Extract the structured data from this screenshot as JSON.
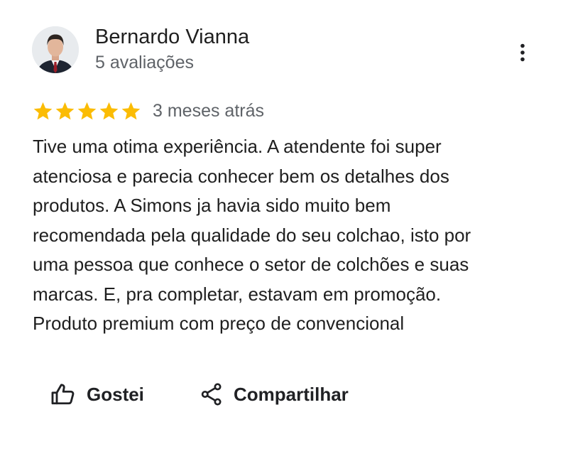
{
  "review": {
    "author": {
      "name": "Bernardo Vianna",
      "reviews_count": "5 avaliações",
      "avatar_icon": "profile-photo-man-in-suit"
    },
    "rating": {
      "stars": 5,
      "max_stars": 5,
      "star_color": "#fbbc04"
    },
    "date": "3 meses atrás",
    "text_lines": [
      "Tive uma otima experiência. A atendente foi super",
      "atenciosa e parecia conhecer bem os detalhes dos",
      "produtos. A Simons ja havia sido muito bem",
      "recomendada pela qualidade do seu colchao, isto por",
      "uma pessoa que conhece o setor de colchões e suas",
      "marcas. E, pra completar, estavam em promoção.",
      "Produto premium com preço de convencional"
    ],
    "menu_icon": "more-vert-icon"
  },
  "actions": {
    "like": {
      "label": "Gostei",
      "icon": "thumb-up-icon"
    },
    "share": {
      "label": "Compartilhar",
      "icon": "share-icon"
    }
  }
}
